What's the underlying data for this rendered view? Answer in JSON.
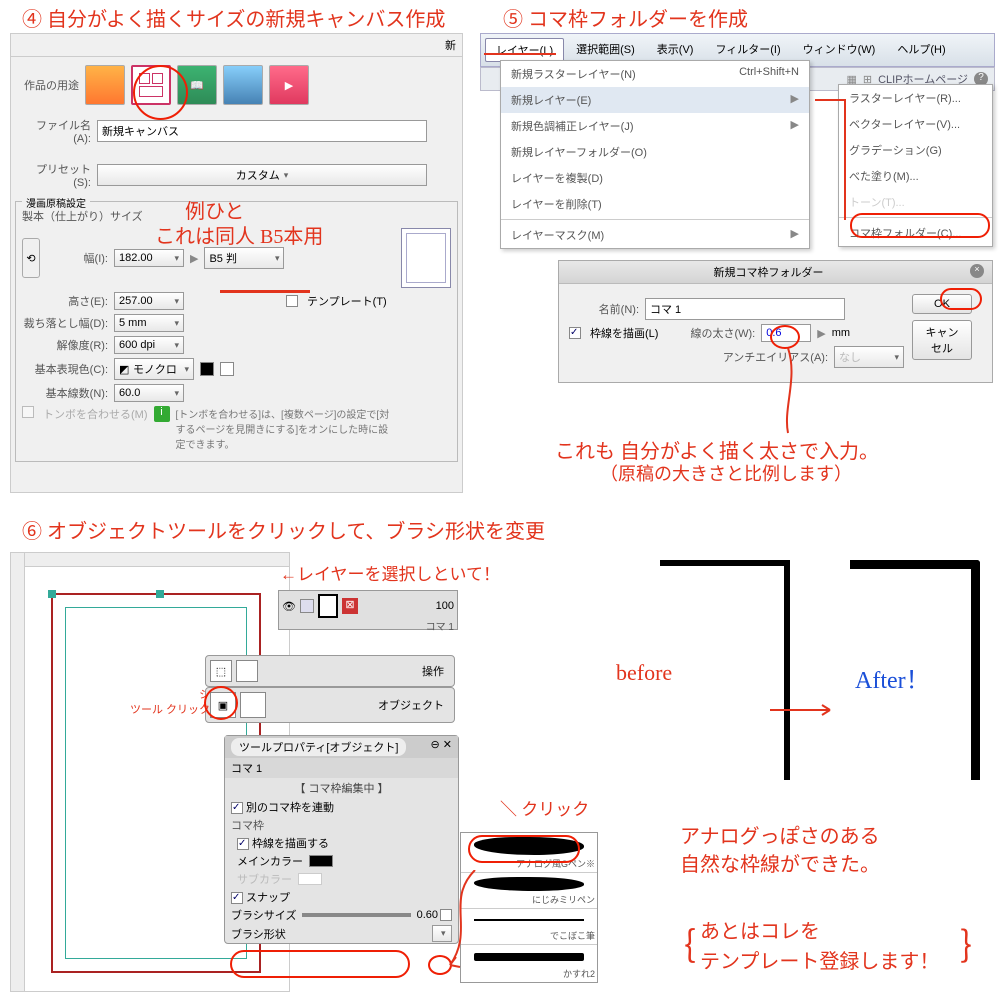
{
  "annotations": {
    "n4_title": "④ 自分がよく描くサイズの新規キャンバス作成",
    "n5_title": "⑤ コマ枠フォルダーを作成",
    "n6_title": "⑥ オブジェクトツールをクリックして、ブラシ形状を変更",
    "example_note1": "例ひと",
    "example_note2": "これは同人 B5本用",
    "layer_note": "←レイヤーを選択しといて！",
    "tool_note": "ツール クリック",
    "click_note": "＼ クリック",
    "thickness_note1": "これも 自分がよく描く太さで入力。",
    "thickness_note2": "（原稿の大きさと比例します）",
    "before": "before",
    "after": "After！",
    "result_note1": "アナログっぽさのある",
    "result_note2": "自然な枠線ができた。",
    "final_note1": "あとはコレを",
    "final_note2": "テンプレート登録します！"
  },
  "new_canvas": {
    "title_char": "新",
    "purpose_label": "作品の用途",
    "filename_label": "ファイル名(A):",
    "filename_value": "新規キャンバス",
    "preset_label": "プリセット(S):",
    "preset_value": "カスタム",
    "manga_group": "漫画原稿設定",
    "binding_label": "製本（仕上がり）サイズ",
    "width_label": "幅(I):",
    "width_value": "182.00",
    "size_preset": "B5 判",
    "height_label": "高さ(E):",
    "height_value": "257.00",
    "template_label": "テンプレート(T)",
    "bleed_label": "裁ち落とし幅(D):",
    "bleed_value": "5 mm",
    "resolution_label": "解像度(R):",
    "resolution_value": "600 dpi",
    "colormode_label": "基本表現色(C):",
    "colormode_value": "モノクロ",
    "linecount_label": "基本線数(N):",
    "linecount_value": "60.0",
    "tombo_label": "トンボを合わせる(M)",
    "tombo_info": "[トンボを合わせる]は、[複数ページ]の設定で[対するページを見開きにする]をオンにした時に設定できます。"
  },
  "menu": {
    "layer": "レイヤー(L)",
    "select": "選択範囲(S)",
    "view": "表示(V)",
    "filter": "フィルター(I)",
    "window": "ウィンドウ(W)",
    "help": "ヘルプ(H)",
    "clip_home": "CLIPホームページ",
    "items": [
      {
        "label": "新規ラスターレイヤー(N)",
        "shortcut": "Ctrl+Shift+N"
      },
      {
        "label": "新規レイヤー(E)",
        "shortcut": "▶"
      },
      {
        "label": "新規色調補正レイヤー(J)",
        "shortcut": "▶"
      },
      {
        "label": "新規レイヤーフォルダー(O)",
        "shortcut": ""
      },
      {
        "label": "レイヤーを複製(D)",
        "shortcut": ""
      },
      {
        "label": "レイヤーを削除(T)",
        "shortcut": ""
      },
      {
        "label": "レイヤーマスク(M)",
        "shortcut": "▶"
      }
    ],
    "sub": [
      "ラスターレイヤー(R)...",
      "ベクターレイヤー(V)...",
      "グラデーション(G)",
      "べた塗り(M)...",
      "トーン(T)...",
      "コマ枠フォルダー(C)..."
    ]
  },
  "frame_dialog": {
    "title": "新規コマ枠フォルダー",
    "name_label": "名前(N):",
    "name_value": "コマ 1",
    "ok": "OK",
    "cancel": "キャンセル",
    "drawborder": "枠線を描画(L)",
    "linewidth_label": "線の太さ(W):",
    "linewidth_value": "0.6",
    "unit": "mm",
    "antialias_label": "アンチエイリアス(A):",
    "antialias_value": "なし"
  },
  "layers": {
    "opacity": "100",
    "layer_name": "コマ 1"
  },
  "tool": {
    "operate": "操作",
    "object": "オブジェクト",
    "property_title": "ツールプロパティ[オブジェクト]",
    "frame_name": "コマ 1",
    "editing": "【 コマ枠編集中 】",
    "link_other": "別のコマ枠を連動",
    "frame_group": "コマ枠",
    "draw_border": "枠線を描画する",
    "main_color": "メインカラー",
    "sub_color": "サブカラー",
    "snap": "スナップ",
    "brush_size": "ブラシサイズ",
    "brush_size_val": "0.60",
    "brush_shape": "ブラシ形状"
  },
  "brushes": [
    "アナログ風Gペン※",
    "にじみミリペン",
    "でこぼこ筆",
    "かすれ2"
  ]
}
